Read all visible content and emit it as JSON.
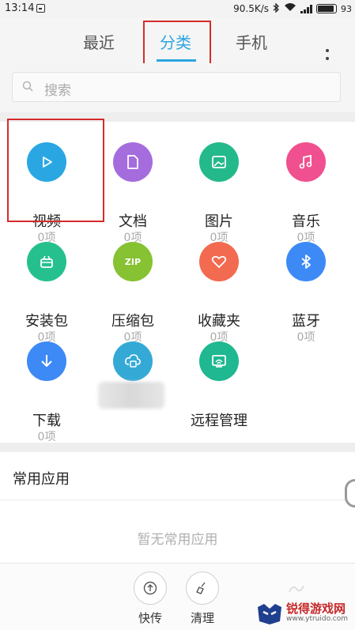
{
  "status_bar": {
    "time": "13:14",
    "speed": "90.5K/s",
    "battery_label": "93"
  },
  "tabs": [
    {
      "label": "最近"
    },
    {
      "label": "分类",
      "active": true
    },
    {
      "label": "手机"
    }
  ],
  "search": {
    "placeholder": "搜索"
  },
  "categories": [
    {
      "label": "视频",
      "count": "0项",
      "icon": "play-icon",
      "color": "#2aa7e3"
    },
    {
      "label": "文档",
      "count": "0项",
      "icon": "document-icon",
      "color": "#a56cde"
    },
    {
      "label": "图片",
      "count": "0项",
      "icon": "image-icon",
      "color": "#24b98b"
    },
    {
      "label": "音乐",
      "count": "0项",
      "icon": "music-note-icon",
      "color": "#f0508f"
    },
    {
      "label": "安装包",
      "count": "0项",
      "icon": "package-icon",
      "color": "#26c08e"
    },
    {
      "label": "压缩包",
      "count": "0项",
      "icon": "zip-icon",
      "color": "#86c232",
      "icon_text": "ZIP"
    },
    {
      "label": "收藏夹",
      "count": "0项",
      "icon": "heart-icon",
      "color": "#f26a4f"
    },
    {
      "label": "蓝牙",
      "count": "0项",
      "icon": "bluetooth-icon",
      "color": "#3d8af7"
    },
    {
      "label": "下载",
      "count": "0项",
      "icon": "download-icon",
      "color": "#3d8af7"
    },
    {
      "label": "",
      "count": "",
      "icon": "cloud-icon",
      "color": "#34a9d6"
    },
    {
      "label": "远程管理",
      "count": "",
      "icon": "remote-management-icon",
      "color": "#1fb890"
    }
  ],
  "common_apps": {
    "title": "常用应用",
    "empty_text": "暂无常用应用"
  },
  "bottom_bar": {
    "quick_send": "快传",
    "clean": "清理"
  },
  "watermark": {
    "title": "锐得游戏网",
    "url": "www.ytruido.com"
  },
  "colors": {
    "accent": "#2ba6e0",
    "annotation_box": "#d62b2b"
  }
}
